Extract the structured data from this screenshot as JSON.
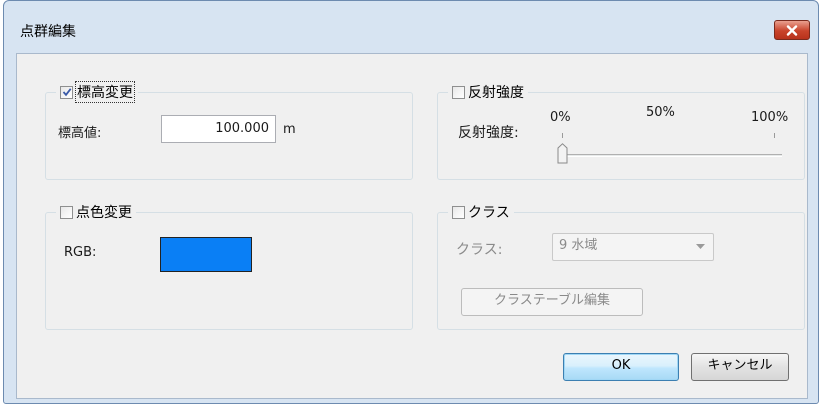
{
  "window": {
    "title": "点群編集"
  },
  "elevation": {
    "legend": "標高変更",
    "checked": true,
    "value_label": "標高値:",
    "value": "100.000",
    "unit": "m"
  },
  "reflectance": {
    "legend": "反射強度",
    "checked": false,
    "slider_label": "反射強度:",
    "ticks": [
      "0%",
      "50%",
      "100%"
    ],
    "slider_value_percent": 0
  },
  "point_color": {
    "legend": "点色変更",
    "checked": false,
    "rgb_label": "RGB:",
    "color": "#0a7ff5"
  },
  "class": {
    "legend": "クラス",
    "checked": false,
    "class_label": "クラス:",
    "selected": "9 水域",
    "edit_table_button": "クラステーブル編集"
  },
  "buttons": {
    "ok": "OK",
    "cancel": "キャンセル"
  },
  "icons": {
    "close": "close-icon",
    "checkmark": "checkmark-icon",
    "dropdown": "chevron-down-icon"
  }
}
